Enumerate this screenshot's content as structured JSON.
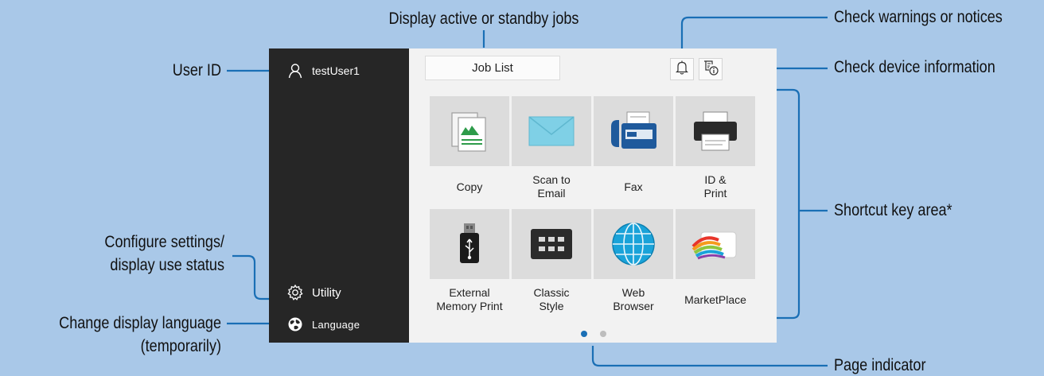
{
  "callouts": {
    "jobs": "Display active or standby jobs",
    "warnings": "Check warnings or notices",
    "device_info": "Check device information",
    "user_id": "User ID",
    "shortcut_area": "Shortcut key area*",
    "settings_1": "Configure settings/",
    "settings_2": "display use status",
    "language_1": "Change display language",
    "language_2": "(temporarily)",
    "page_indicator": "Page indicator"
  },
  "sidebar": {
    "user": "testUser1",
    "utility": "Utility",
    "language": "Language"
  },
  "header": {
    "job_list": "Job List"
  },
  "tiles": [
    {
      "label": "Copy",
      "icon": "copy-icon"
    },
    {
      "label": "Scan to\nEmail",
      "icon": "envelope-icon"
    },
    {
      "label": "Fax",
      "icon": "fax-icon"
    },
    {
      "label": "ID &\nPrint",
      "icon": "printer-icon"
    },
    {
      "label": "External\nMemory Print",
      "icon": "usb-icon"
    },
    {
      "label": "Classic\nStyle",
      "icon": "keypad-icon"
    },
    {
      "label": "Web\nBrowser",
      "icon": "globe-icon"
    },
    {
      "label": "MarketPlace",
      "icon": "marketplace-icon"
    }
  ],
  "pages": {
    "total": 2,
    "current": 1
  },
  "colors": {
    "callout_line": "#1a6fb5",
    "active_dot": "#1a6fb5",
    "inactive_dot": "#bdbdbd",
    "sidebar": "#262626"
  }
}
